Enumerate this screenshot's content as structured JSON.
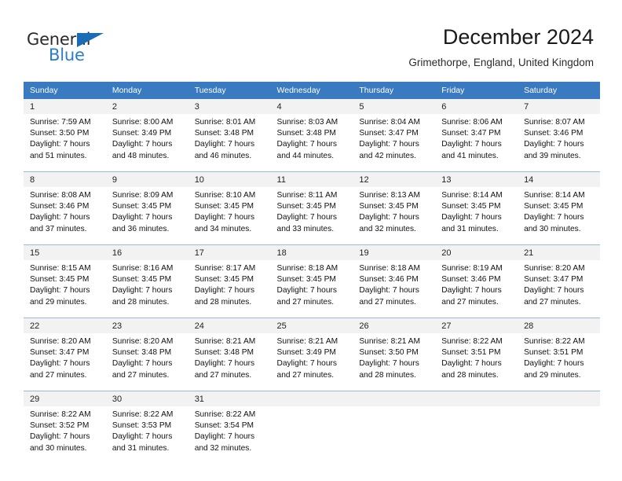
{
  "brand": {
    "name_part1": "General",
    "name_part2": "Blue",
    "triangle_icon": "logo-triangle-icon",
    "colors": {
      "dark": "#2b2b2b",
      "blue": "#2a7ec4",
      "triangle": "#1a6cb5"
    }
  },
  "header": {
    "title": "December 2024",
    "subtitle": "Grimethorpe, England, United Kingdom"
  },
  "calendar": {
    "header_bg": "#3a7ac0",
    "header_text_color": "#ffffff",
    "daynum_bg": "#f2f2f2",
    "weekday_headers": [
      "Sunday",
      "Monday",
      "Tuesday",
      "Wednesday",
      "Thursday",
      "Friday",
      "Saturday"
    ],
    "weeks": [
      [
        {
          "day": "1",
          "sunrise": "Sunrise: 7:59 AM",
          "sunset": "Sunset: 3:50 PM",
          "daylight1": "Daylight: 7 hours",
          "daylight2": "and 51 minutes."
        },
        {
          "day": "2",
          "sunrise": "Sunrise: 8:00 AM",
          "sunset": "Sunset: 3:49 PM",
          "daylight1": "Daylight: 7 hours",
          "daylight2": "and 48 minutes."
        },
        {
          "day": "3",
          "sunrise": "Sunrise: 8:01 AM",
          "sunset": "Sunset: 3:48 PM",
          "daylight1": "Daylight: 7 hours",
          "daylight2": "and 46 minutes."
        },
        {
          "day": "4",
          "sunrise": "Sunrise: 8:03 AM",
          "sunset": "Sunset: 3:48 PM",
          "daylight1": "Daylight: 7 hours",
          "daylight2": "and 44 minutes."
        },
        {
          "day": "5",
          "sunrise": "Sunrise: 8:04 AM",
          "sunset": "Sunset: 3:47 PM",
          "daylight1": "Daylight: 7 hours",
          "daylight2": "and 42 minutes."
        },
        {
          "day": "6",
          "sunrise": "Sunrise: 8:06 AM",
          "sunset": "Sunset: 3:47 PM",
          "daylight1": "Daylight: 7 hours",
          "daylight2": "and 41 minutes."
        },
        {
          "day": "7",
          "sunrise": "Sunrise: 8:07 AM",
          "sunset": "Sunset: 3:46 PM",
          "daylight1": "Daylight: 7 hours",
          "daylight2": "and 39 minutes."
        }
      ],
      [
        {
          "day": "8",
          "sunrise": "Sunrise: 8:08 AM",
          "sunset": "Sunset: 3:46 PM",
          "daylight1": "Daylight: 7 hours",
          "daylight2": "and 37 minutes."
        },
        {
          "day": "9",
          "sunrise": "Sunrise: 8:09 AM",
          "sunset": "Sunset: 3:45 PM",
          "daylight1": "Daylight: 7 hours",
          "daylight2": "and 36 minutes."
        },
        {
          "day": "10",
          "sunrise": "Sunrise: 8:10 AM",
          "sunset": "Sunset: 3:45 PM",
          "daylight1": "Daylight: 7 hours",
          "daylight2": "and 34 minutes."
        },
        {
          "day": "11",
          "sunrise": "Sunrise: 8:11 AM",
          "sunset": "Sunset: 3:45 PM",
          "daylight1": "Daylight: 7 hours",
          "daylight2": "and 33 minutes."
        },
        {
          "day": "12",
          "sunrise": "Sunrise: 8:13 AM",
          "sunset": "Sunset: 3:45 PM",
          "daylight1": "Daylight: 7 hours",
          "daylight2": "and 32 minutes."
        },
        {
          "day": "13",
          "sunrise": "Sunrise: 8:14 AM",
          "sunset": "Sunset: 3:45 PM",
          "daylight1": "Daylight: 7 hours",
          "daylight2": "and 31 minutes."
        },
        {
          "day": "14",
          "sunrise": "Sunrise: 8:14 AM",
          "sunset": "Sunset: 3:45 PM",
          "daylight1": "Daylight: 7 hours",
          "daylight2": "and 30 minutes."
        }
      ],
      [
        {
          "day": "15",
          "sunrise": "Sunrise: 8:15 AM",
          "sunset": "Sunset: 3:45 PM",
          "daylight1": "Daylight: 7 hours",
          "daylight2": "and 29 minutes."
        },
        {
          "day": "16",
          "sunrise": "Sunrise: 8:16 AM",
          "sunset": "Sunset: 3:45 PM",
          "daylight1": "Daylight: 7 hours",
          "daylight2": "and 28 minutes."
        },
        {
          "day": "17",
          "sunrise": "Sunrise: 8:17 AM",
          "sunset": "Sunset: 3:45 PM",
          "daylight1": "Daylight: 7 hours",
          "daylight2": "and 28 minutes."
        },
        {
          "day": "18",
          "sunrise": "Sunrise: 8:18 AM",
          "sunset": "Sunset: 3:45 PM",
          "daylight1": "Daylight: 7 hours",
          "daylight2": "and 27 minutes."
        },
        {
          "day": "19",
          "sunrise": "Sunrise: 8:18 AM",
          "sunset": "Sunset: 3:46 PM",
          "daylight1": "Daylight: 7 hours",
          "daylight2": "and 27 minutes."
        },
        {
          "day": "20",
          "sunrise": "Sunrise: 8:19 AM",
          "sunset": "Sunset: 3:46 PM",
          "daylight1": "Daylight: 7 hours",
          "daylight2": "and 27 minutes."
        },
        {
          "day": "21",
          "sunrise": "Sunrise: 8:20 AM",
          "sunset": "Sunset: 3:47 PM",
          "daylight1": "Daylight: 7 hours",
          "daylight2": "and 27 minutes."
        }
      ],
      [
        {
          "day": "22",
          "sunrise": "Sunrise: 8:20 AM",
          "sunset": "Sunset: 3:47 PM",
          "daylight1": "Daylight: 7 hours",
          "daylight2": "and 27 minutes."
        },
        {
          "day": "23",
          "sunrise": "Sunrise: 8:20 AM",
          "sunset": "Sunset: 3:48 PM",
          "daylight1": "Daylight: 7 hours",
          "daylight2": "and 27 minutes."
        },
        {
          "day": "24",
          "sunrise": "Sunrise: 8:21 AM",
          "sunset": "Sunset: 3:48 PM",
          "daylight1": "Daylight: 7 hours",
          "daylight2": "and 27 minutes."
        },
        {
          "day": "25",
          "sunrise": "Sunrise: 8:21 AM",
          "sunset": "Sunset: 3:49 PM",
          "daylight1": "Daylight: 7 hours",
          "daylight2": "and 27 minutes."
        },
        {
          "day": "26",
          "sunrise": "Sunrise: 8:21 AM",
          "sunset": "Sunset: 3:50 PM",
          "daylight1": "Daylight: 7 hours",
          "daylight2": "and 28 minutes."
        },
        {
          "day": "27",
          "sunrise": "Sunrise: 8:22 AM",
          "sunset": "Sunset: 3:51 PM",
          "daylight1": "Daylight: 7 hours",
          "daylight2": "and 28 minutes."
        },
        {
          "day": "28",
          "sunrise": "Sunrise: 8:22 AM",
          "sunset": "Sunset: 3:51 PM",
          "daylight1": "Daylight: 7 hours",
          "daylight2": "and 29 minutes."
        }
      ],
      [
        {
          "day": "29",
          "sunrise": "Sunrise: 8:22 AM",
          "sunset": "Sunset: 3:52 PM",
          "daylight1": "Daylight: 7 hours",
          "daylight2": "and 30 minutes."
        },
        {
          "day": "30",
          "sunrise": "Sunrise: 8:22 AM",
          "sunset": "Sunset: 3:53 PM",
          "daylight1": "Daylight: 7 hours",
          "daylight2": "and 31 minutes."
        },
        {
          "day": "31",
          "sunrise": "Sunrise: 8:22 AM",
          "sunset": "Sunset: 3:54 PM",
          "daylight1": "Daylight: 7 hours",
          "daylight2": "and 32 minutes."
        },
        null,
        null,
        null,
        null
      ]
    ]
  }
}
